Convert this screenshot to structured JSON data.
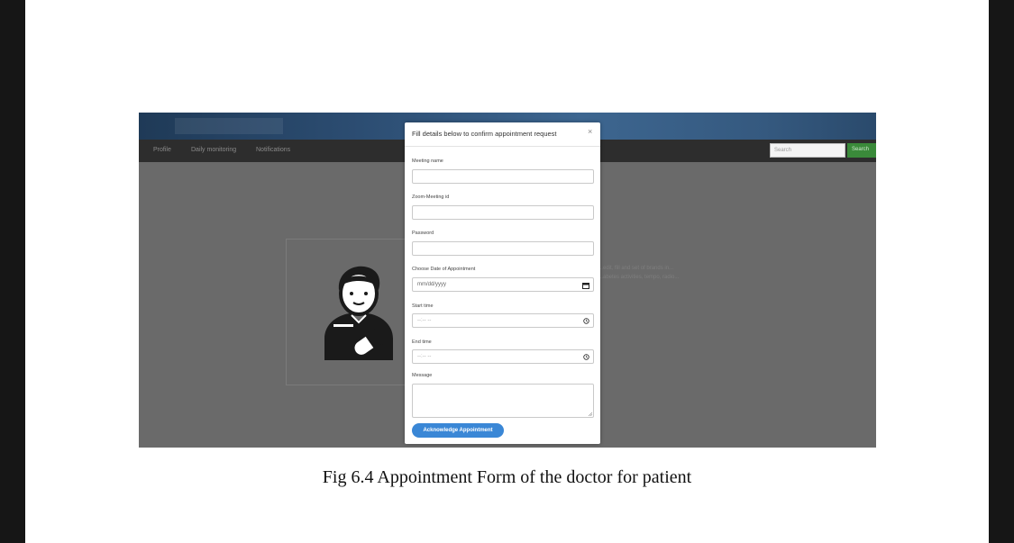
{
  "document": {
    "caption": "Fig 6.4 Appointment Form of the doctor for patient"
  },
  "app": {
    "nav": {
      "items": [
        "Profile",
        "Daily monitoring",
        "Notifications"
      ],
      "search_placeholder": "Search",
      "search_button": "Search"
    },
    "background_text": {
      "line1": "...edit, fill and set of brands in...",
      "line2": "...abetes activities, tempo, radio..."
    }
  },
  "modal": {
    "title": "Fill details below to confirm appointment request",
    "close_label": "×",
    "fields": {
      "meeting_name": {
        "label": "Meeting name"
      },
      "zoom_id": {
        "label": "Zoom-Meeting id"
      },
      "password": {
        "label": "Password"
      },
      "date": {
        "label": "Choose Date of Appointment",
        "placeholder": "mm/dd/yyyy"
      },
      "start_time": {
        "label": "Start time",
        "placeholder": "--:-- --"
      },
      "end_time": {
        "label": "End time",
        "placeholder": "--:-- --"
      },
      "message": {
        "label": "Message"
      }
    },
    "submit_label": "Acknowledge Appointment"
  },
  "colors": {
    "accent_button": "#3a87d6",
    "search_button": "#3a8a3a",
    "overlay": "#6a6a6a"
  },
  "icons": [
    "doctor-avatar-icon",
    "calendar-icon",
    "clock-icon",
    "close-icon",
    "resize-grip-icon"
  ]
}
